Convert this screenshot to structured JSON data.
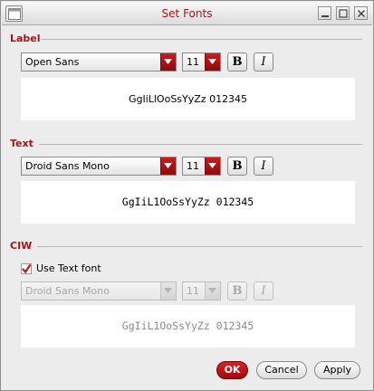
{
  "window": {
    "title": "Set Fonts"
  },
  "label_section": {
    "heading": "Label",
    "font_family": "Open Sans",
    "font_size": "11",
    "bold_glyph": "B",
    "italic_glyph": "I",
    "preview_text": "GgIiLlOoSsYyZz 012345"
  },
  "text_section": {
    "heading": "Text",
    "font_family": "Droid Sans Mono",
    "font_size": "11",
    "bold_glyph": "B",
    "italic_glyph": "I",
    "preview_text": "GgIiL1OoSsYyZz 012345"
  },
  "ciw_section": {
    "heading": "CIW",
    "use_text_font_label": "Use Text font",
    "use_text_font_checked": true,
    "font_family": "Droid Sans Mono",
    "font_size": "11",
    "bold_glyph": "B",
    "italic_glyph": "I",
    "preview_text": "GgIiL1OoSsYyZz 012345"
  },
  "buttons": {
    "ok": "OK",
    "cancel": "Cancel",
    "apply": "Apply"
  },
  "colors": {
    "accent": "#b0161a",
    "primary_button": "#c41717"
  },
  "icons": {
    "app": "app-window-icon",
    "minimize": "minimize-icon",
    "maximize": "maximize-icon",
    "close": "close-icon",
    "dropdown": "chevron-down-icon",
    "check": "checkmark-icon"
  }
}
